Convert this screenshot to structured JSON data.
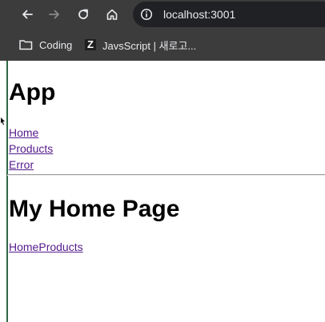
{
  "browser": {
    "url": "localhost:3001",
    "bookmarks": [
      {
        "label": "Coding",
        "icon": "folder-icon"
      },
      {
        "label": "JavsScript | 새로고...",
        "icon": "z-logo-icon"
      }
    ],
    "z_logo_letter": "Z"
  },
  "page": {
    "app_title": "App",
    "nav_links": [
      "Home",
      "Products",
      "Error"
    ],
    "page_title": "My Home Page",
    "inline_links": [
      "Home",
      "Products"
    ]
  },
  "colors": {
    "chrome_bg": "#3c3c3c",
    "omnibox_bg": "#202124",
    "link_visited": "#551a8b"
  }
}
